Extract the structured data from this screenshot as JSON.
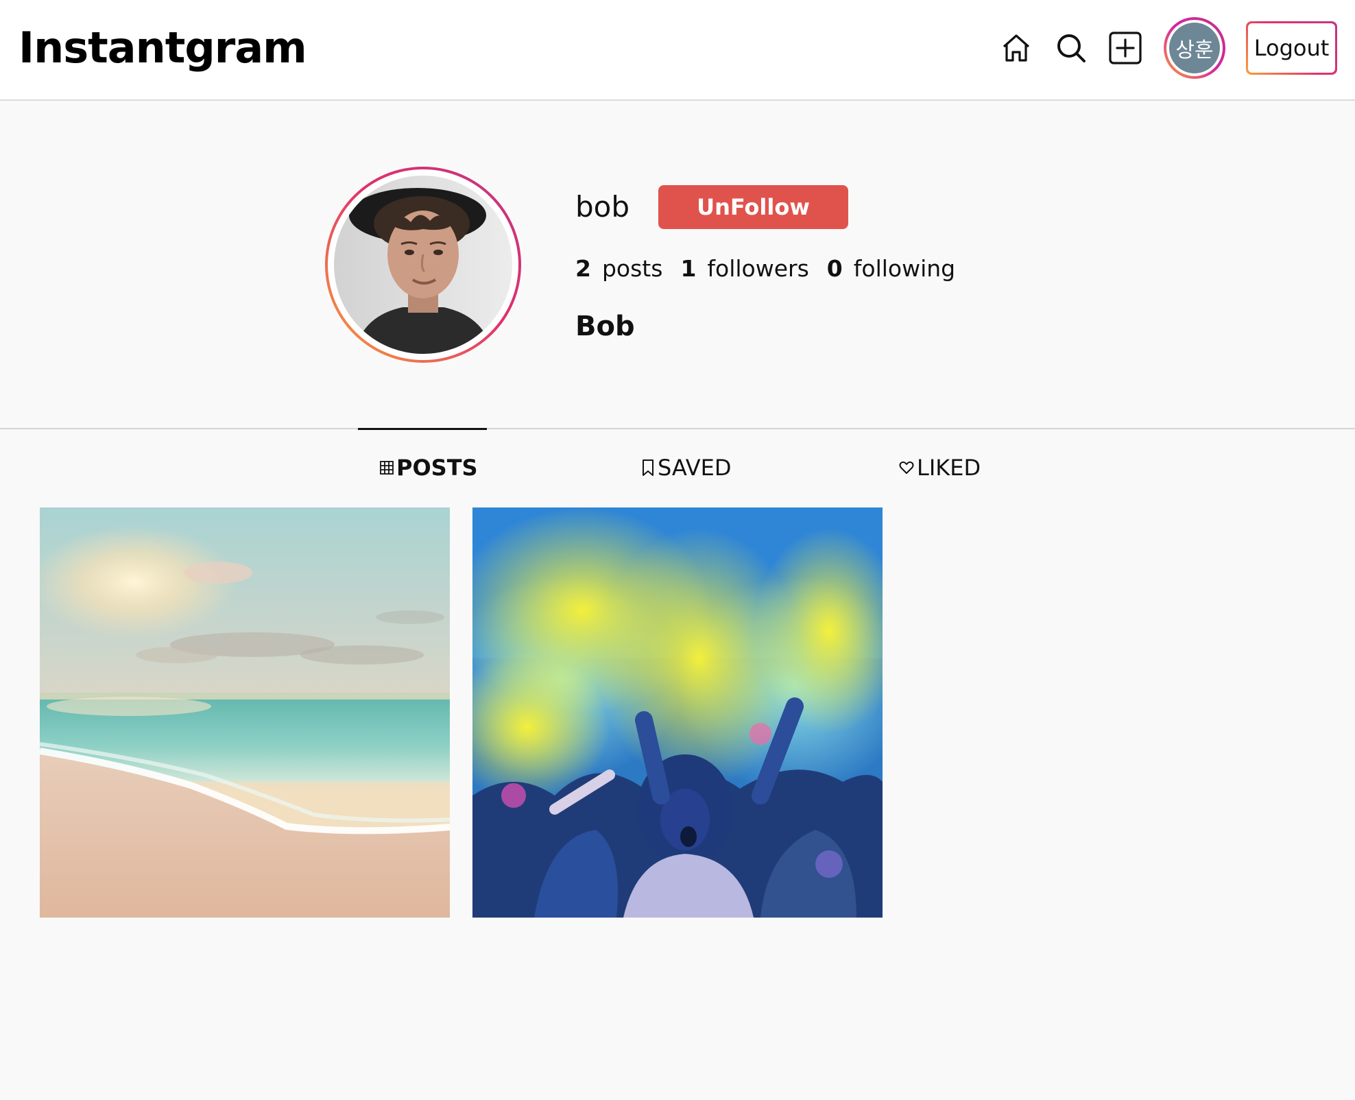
{
  "header": {
    "logo": "Instantgram",
    "icons": [
      "home-icon",
      "search-icon",
      "add-post-icon"
    ],
    "avatar_text": "상훈",
    "logout_label": "Logout"
  },
  "profile": {
    "username": "bob",
    "follow_button_label": "UnFollow",
    "stats": [
      {
        "count": "2",
        "label": "posts"
      },
      {
        "count": "1",
        "label": "followers"
      },
      {
        "count": "0",
        "label": "following"
      }
    ],
    "name": "Bob"
  },
  "tabs": [
    {
      "label": "POSTS",
      "icon": "grid-icon",
      "active": true
    },
    {
      "label": "SAVED",
      "icon": "bookmark-icon",
      "active": false
    },
    {
      "label": "LIKED",
      "icon": "heart-icon",
      "active": false
    }
  ],
  "colors": {
    "unfollow": "#e0534c",
    "gradient_start": "#f9a23a",
    "gradient_end": "#c13584",
    "avatar_bg": "#6d8796"
  }
}
